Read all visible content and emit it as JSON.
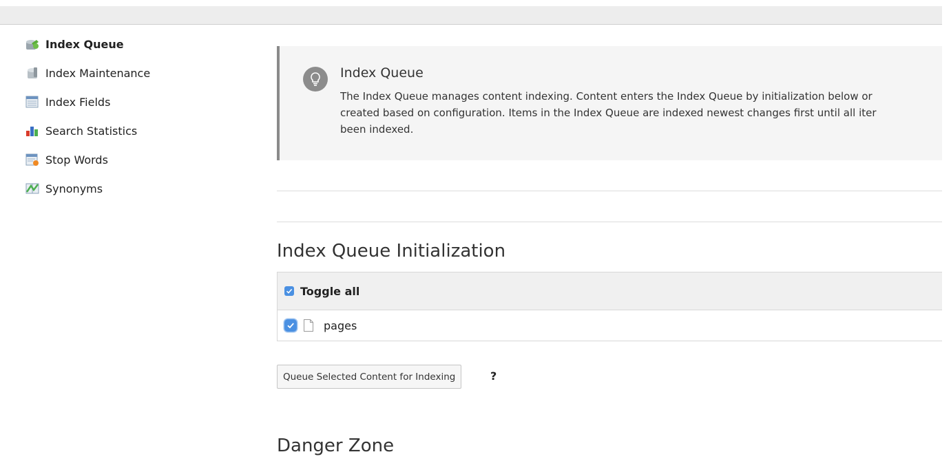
{
  "sidebar": {
    "items": [
      {
        "label": "Index Queue",
        "icon": "index-queue-icon",
        "active": true
      },
      {
        "label": "Index Maintenance",
        "icon": "index-maintenance-icon"
      },
      {
        "label": "Index Fields",
        "icon": "index-fields-icon"
      },
      {
        "label": "Search Statistics",
        "icon": "search-statistics-icon"
      },
      {
        "label": "Stop Words",
        "icon": "stop-words-icon"
      },
      {
        "label": "Synonyms",
        "icon": "synonyms-icon"
      }
    ]
  },
  "callout": {
    "icon": "lightbulb-icon",
    "title": "Index Queue",
    "lines": [
      "The Index Queue manages content indexing. Content enters the Index Queue by initialization below or",
      "created based on configuration. Items in the Index Queue are indexed newest changes first until all iter",
      "been indexed."
    ]
  },
  "initialization": {
    "heading": "Index Queue Initialization",
    "toggle_all_label": "Toggle all",
    "rows": [
      {
        "label": "pages",
        "checked": true,
        "icon": "page-icon"
      }
    ],
    "queue_button": "Queue Selected Content for Indexing",
    "help_label": "?"
  },
  "danger": {
    "heading": "Danger Zone"
  },
  "colors": {
    "checkbox": "#4a90e2",
    "callout_bg": "#f5f5f5",
    "callout_border": "#8a8a8a",
    "topbar_bg": "#ededed"
  }
}
